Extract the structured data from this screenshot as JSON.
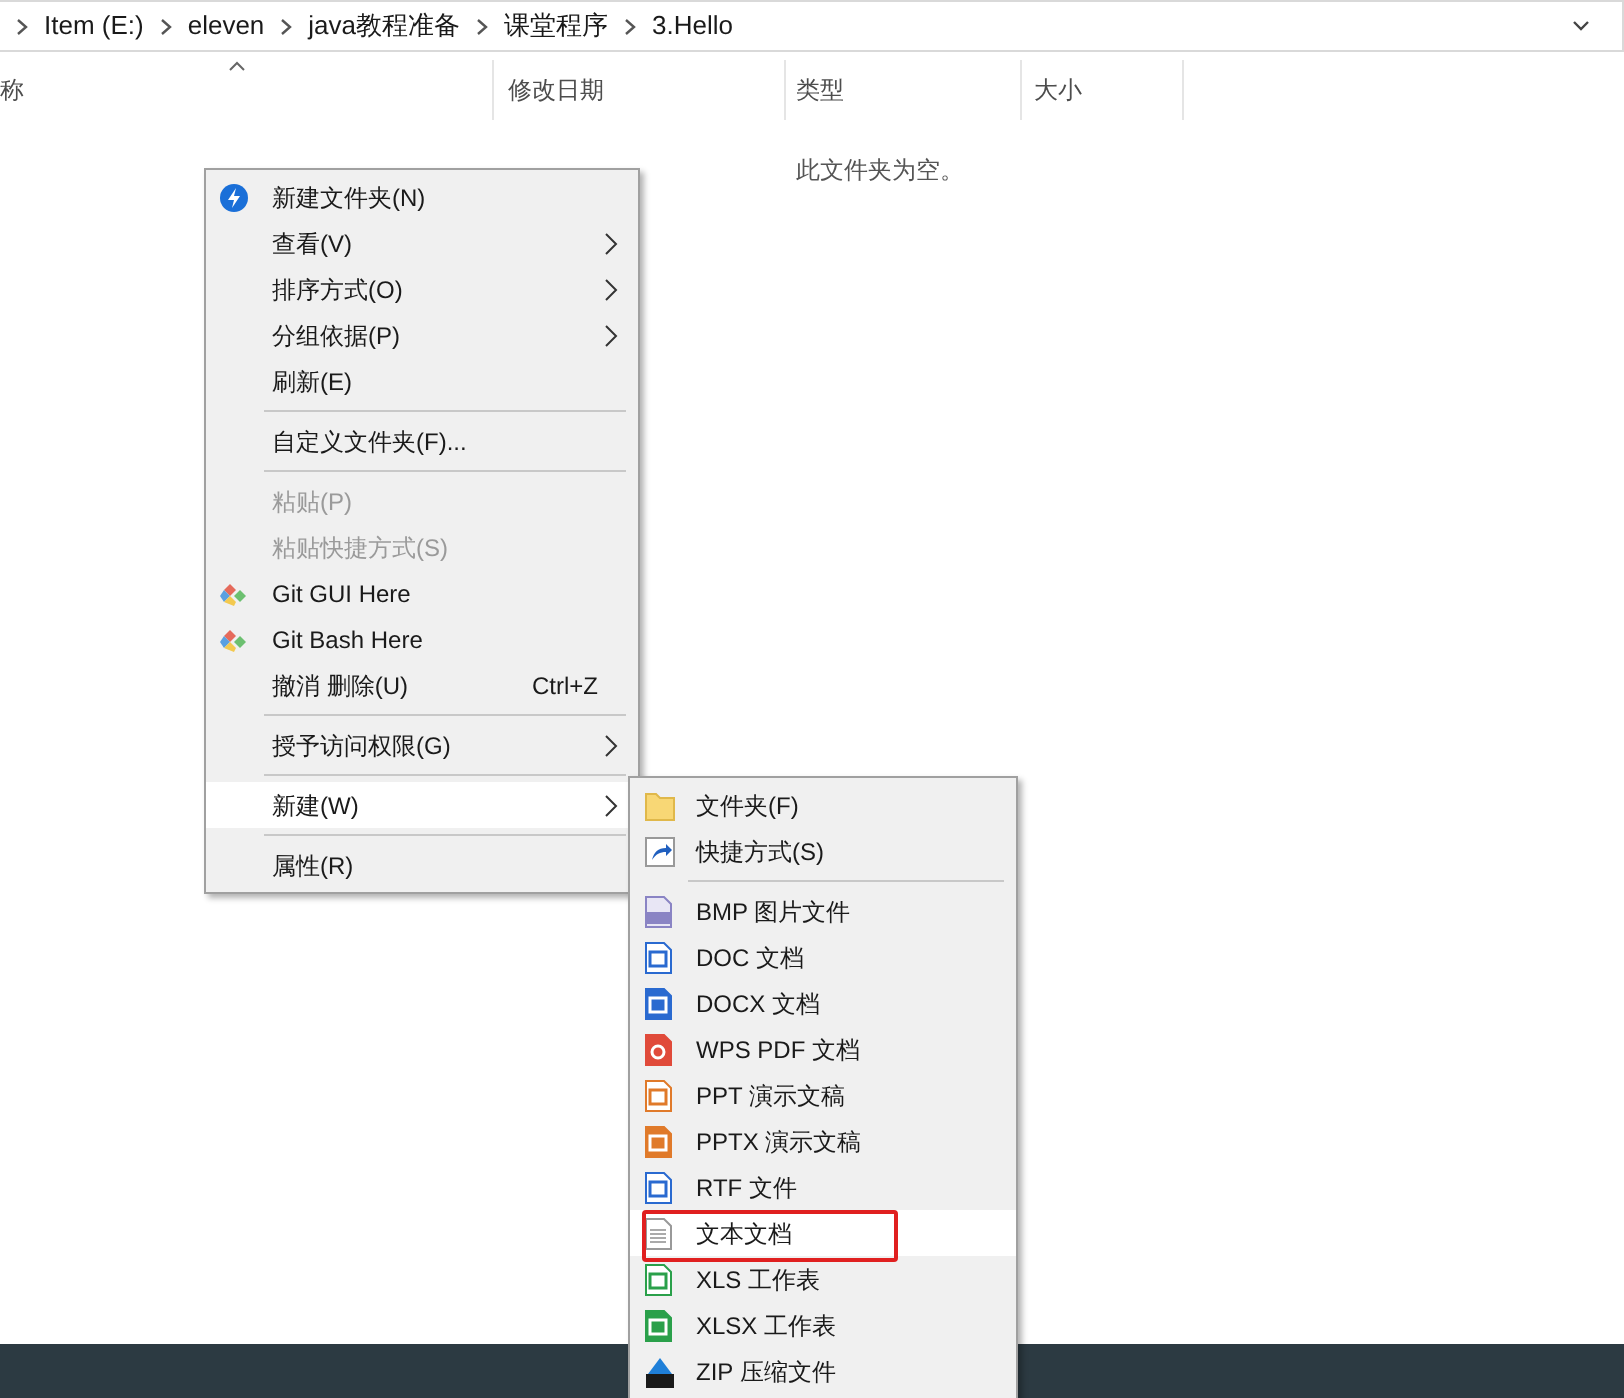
{
  "breadcrumb": [
    "Item (E:)",
    "eleven",
    "java教程准备",
    "课堂程序",
    "3.Hello"
  ],
  "columns": [
    {
      "label": "称",
      "sorted": true
    },
    {
      "label": "修改日期",
      "sorted": false
    },
    {
      "label": "类型",
      "sorted": false
    },
    {
      "label": "大小",
      "sorted": false
    }
  ],
  "empty_message": "此文件夹为空。",
  "context_menu": [
    {
      "kind": "item",
      "label": "新建文件夹(N)",
      "submenu": false,
      "disabled": false,
      "selected": false
    },
    {
      "kind": "item",
      "label": "查看(V)",
      "submenu": true,
      "disabled": false,
      "selected": false
    },
    {
      "kind": "item",
      "label": "排序方式(O)",
      "submenu": true,
      "disabled": false,
      "selected": false
    },
    {
      "kind": "item",
      "label": "分组依据(P)",
      "submenu": true,
      "disabled": false,
      "selected": false
    },
    {
      "kind": "item",
      "label": "刷新(E)",
      "submenu": false,
      "disabled": false,
      "selected": false
    },
    {
      "kind": "separator"
    },
    {
      "kind": "item",
      "label": "自定义文件夹(F)...",
      "submenu": false,
      "disabled": false,
      "selected": false
    },
    {
      "kind": "separator"
    },
    {
      "kind": "item",
      "label": "粘贴(P)",
      "submenu": false,
      "disabled": true,
      "selected": false
    },
    {
      "kind": "item",
      "label": "粘贴快捷方式(S)",
      "submenu": false,
      "disabled": true,
      "selected": false
    },
    {
      "kind": "item",
      "label": "Git GUI Here",
      "submenu": false,
      "disabled": false,
      "selected": false
    },
    {
      "kind": "item",
      "label": "Git Bash Here",
      "submenu": false,
      "disabled": false,
      "selected": false
    },
    {
      "kind": "item",
      "label": "撤消 删除(U)",
      "shortcut": "Ctrl+Z",
      "submenu": false,
      "disabled": false,
      "selected": false
    },
    {
      "kind": "separator"
    },
    {
      "kind": "item",
      "label": "授予访问权限(G)",
      "submenu": true,
      "disabled": false,
      "selected": false
    },
    {
      "kind": "separator"
    },
    {
      "kind": "item",
      "label": "新建(W)",
      "submenu": true,
      "disabled": false,
      "selected": true
    },
    {
      "kind": "separator"
    },
    {
      "kind": "item",
      "label": "属性(R)",
      "submenu": false,
      "disabled": false,
      "selected": false
    }
  ],
  "new_submenu": [
    {
      "kind": "item",
      "label": "文件夹(F)",
      "selected": false,
      "marked": false
    },
    {
      "kind": "item",
      "label": "快捷方式(S)",
      "selected": false,
      "marked": false
    },
    {
      "kind": "separator"
    },
    {
      "kind": "item",
      "label": "BMP 图片文件",
      "selected": false,
      "marked": false
    },
    {
      "kind": "item",
      "label": "DOC 文档",
      "selected": false,
      "marked": false
    },
    {
      "kind": "item",
      "label": "DOCX 文档",
      "selected": false,
      "marked": false
    },
    {
      "kind": "item",
      "label": "WPS PDF 文档",
      "selected": false,
      "marked": false
    },
    {
      "kind": "item",
      "label": "PPT 演示文稿",
      "selected": false,
      "marked": false
    },
    {
      "kind": "item",
      "label": "PPTX 演示文稿",
      "selected": false,
      "marked": false
    },
    {
      "kind": "item",
      "label": "RTF 文件",
      "selected": false,
      "marked": false
    },
    {
      "kind": "item",
      "label": "文本文档",
      "selected": true,
      "marked": true
    },
    {
      "kind": "item",
      "label": "XLS 工作表",
      "selected": false,
      "marked": false
    },
    {
      "kind": "item",
      "label": "XLSX 工作表",
      "selected": false,
      "marked": false
    },
    {
      "kind": "item",
      "label": "ZIP 压缩文件",
      "selected": false,
      "marked": false
    }
  ]
}
